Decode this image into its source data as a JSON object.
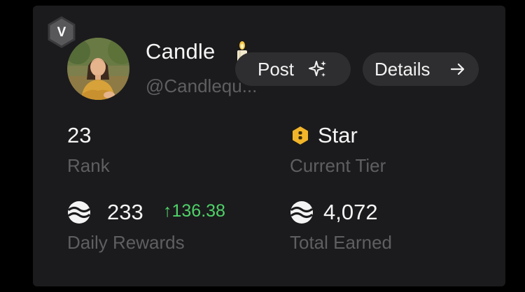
{
  "profile": {
    "verified_letter": "V",
    "display_name": "Candle",
    "handle": "@Candlequ...",
    "avatar": "avatar-illustration-woman-yellow-top",
    "name_emoji": "candle-icon"
  },
  "actions": {
    "post_label": "Post",
    "post_icon": "sparkles-icon",
    "details_label": "Details",
    "details_icon": "arrow-right-icon"
  },
  "stats": {
    "rank_value": "23",
    "rank_label": "Rank",
    "tier_value": "Star",
    "tier_label": "Current Tier",
    "tier_icon": "star-tier-hexagon-icon",
    "daily_value": "233",
    "daily_change": "↑136.38",
    "daily_label": "Daily Rewards",
    "total_value": "4,072",
    "total_label": "Total Earned",
    "reward_icon": "wave-coin-icon"
  },
  "colors": {
    "card_bg": "#1b1b1d",
    "page_bg": "#000000",
    "primary_text": "#f5f5f5",
    "muted_text": "#5f5f62",
    "positive": "#4fd168",
    "button_bg": "#2e2e30",
    "tier_gold": "#f2b429"
  }
}
